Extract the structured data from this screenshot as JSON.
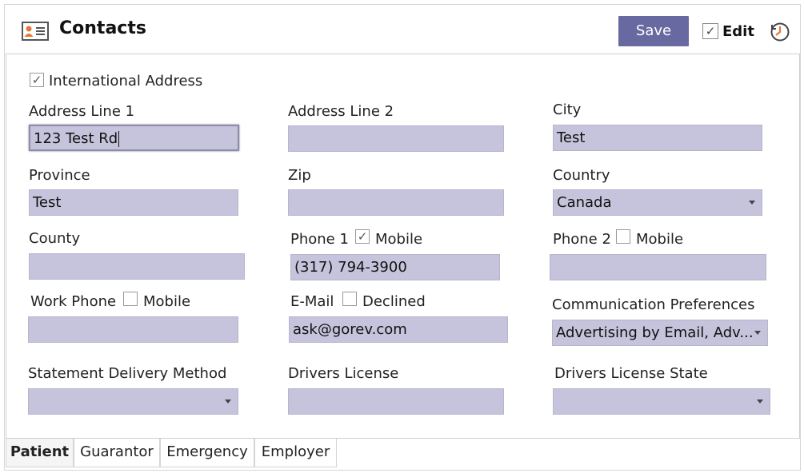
{
  "header": {
    "title": "Contacts",
    "save_label": "Save",
    "edit_label": "Edit",
    "edit_checked": true
  },
  "form": {
    "international": {
      "label": "International Address",
      "checked": true
    },
    "address1": {
      "label": "Address Line 1",
      "value": "123 Test Rd"
    },
    "address2": {
      "label": "Address Line 2",
      "value": ""
    },
    "city": {
      "label": "City",
      "value": "Test"
    },
    "province": {
      "label": "Province",
      "value": "Test"
    },
    "zip": {
      "label": "Zip",
      "value": ""
    },
    "country": {
      "label": "Country",
      "value": "Canada"
    },
    "county": {
      "label": "County",
      "value": ""
    },
    "phone1": {
      "label": "Phone 1",
      "mobile_label": "Mobile",
      "mobile_checked": true,
      "value": "(317) 794-3900"
    },
    "phone2": {
      "label": "Phone 2",
      "mobile_label": "Mobile",
      "mobile_checked": false,
      "value": ""
    },
    "work_phone": {
      "label": "Work Phone",
      "mobile_label": "Mobile",
      "mobile_checked": false,
      "value": ""
    },
    "email": {
      "label": "E-Mail",
      "declined_label": "Declined",
      "declined_checked": false,
      "value": "ask@gorev.com"
    },
    "comm_prefs": {
      "label": "Communication Preferences",
      "value": "Advertising by Email, Adv..."
    },
    "statement_delivery": {
      "label": "Statement Delivery Method",
      "value": ""
    },
    "drivers_license": {
      "label": "Drivers License",
      "value": ""
    },
    "drivers_license_state": {
      "label": "Drivers License State",
      "value": ""
    }
  },
  "tabs": [
    {
      "label": "Patient",
      "active": true
    },
    {
      "label": "Guarantor",
      "active": false
    },
    {
      "label": "Emergency",
      "active": false
    },
    {
      "label": "Employer",
      "active": false
    }
  ],
  "icons": {
    "contacts": "contact-card-icon",
    "history": "clock-history-icon",
    "check": "✓"
  },
  "colors": {
    "accent": "#6869a0",
    "field_bg": "#c5c4dc"
  }
}
